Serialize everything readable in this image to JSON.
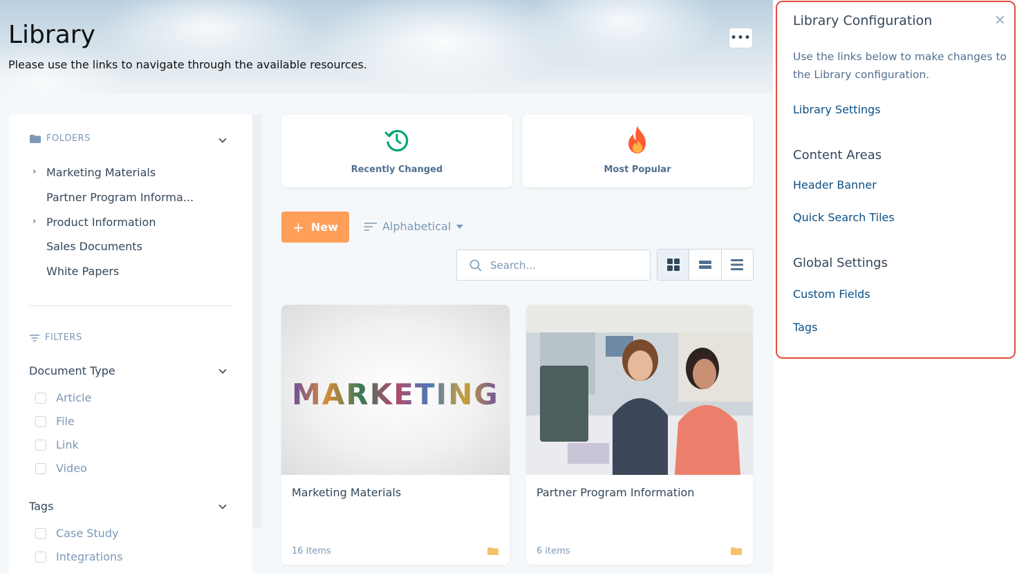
{
  "header": {
    "title": "Library",
    "subtitle": "Please use the links to navigate through the available resources.",
    "more_label": "•••"
  },
  "sidebar": {
    "folders_header": "FOLDERS",
    "folders": [
      {
        "label": "Marketing Materials",
        "expandable": true
      },
      {
        "label": "Partner Program Informa...",
        "expandable": false
      },
      {
        "label": "Product Information",
        "expandable": true
      },
      {
        "label": "Sales Documents",
        "expandable": false
      },
      {
        "label": "White Papers",
        "expandable": false
      }
    ],
    "filters_header": "FILTERS",
    "document_type": {
      "label": "Document Type",
      "options": [
        "Article",
        "File",
        "Link",
        "Video"
      ]
    },
    "tags": {
      "label": "Tags",
      "options": [
        "Case Study",
        "Integrations"
      ]
    }
  },
  "tiles": [
    {
      "label": "Recently Changed",
      "icon": "history-icon",
      "color": "#00a86b"
    },
    {
      "label": "Most Popular",
      "icon": "flame-icon",
      "color": "#ff5c35"
    }
  ],
  "toolbar": {
    "new_label": "New",
    "sort_label": "Alphabetical",
    "search_placeholder": "Search..."
  },
  "cards": [
    {
      "title": "Marketing Materials",
      "count": "16 items",
      "image_text": "MARKETING"
    },
    {
      "title": "Partner Program Information",
      "count": "6 items"
    }
  ],
  "panel": {
    "title": "Library Configuration",
    "description": "Use the links below to make changes to the Library configuration.",
    "library_settings": "Library Settings",
    "content_areas_heading": "Content Areas",
    "header_banner": "Header Banner",
    "quick_search_tiles": "Quick Search Tiles",
    "global_settings_heading": "Global Settings",
    "custom_fields": "Custom Fields",
    "tags": "Tags"
  },
  "colors": {
    "accent": "#ff9f5a",
    "link": "#0b4f85",
    "panel_border": "#e14c3b",
    "folder_icon": "#f5c26b"
  }
}
